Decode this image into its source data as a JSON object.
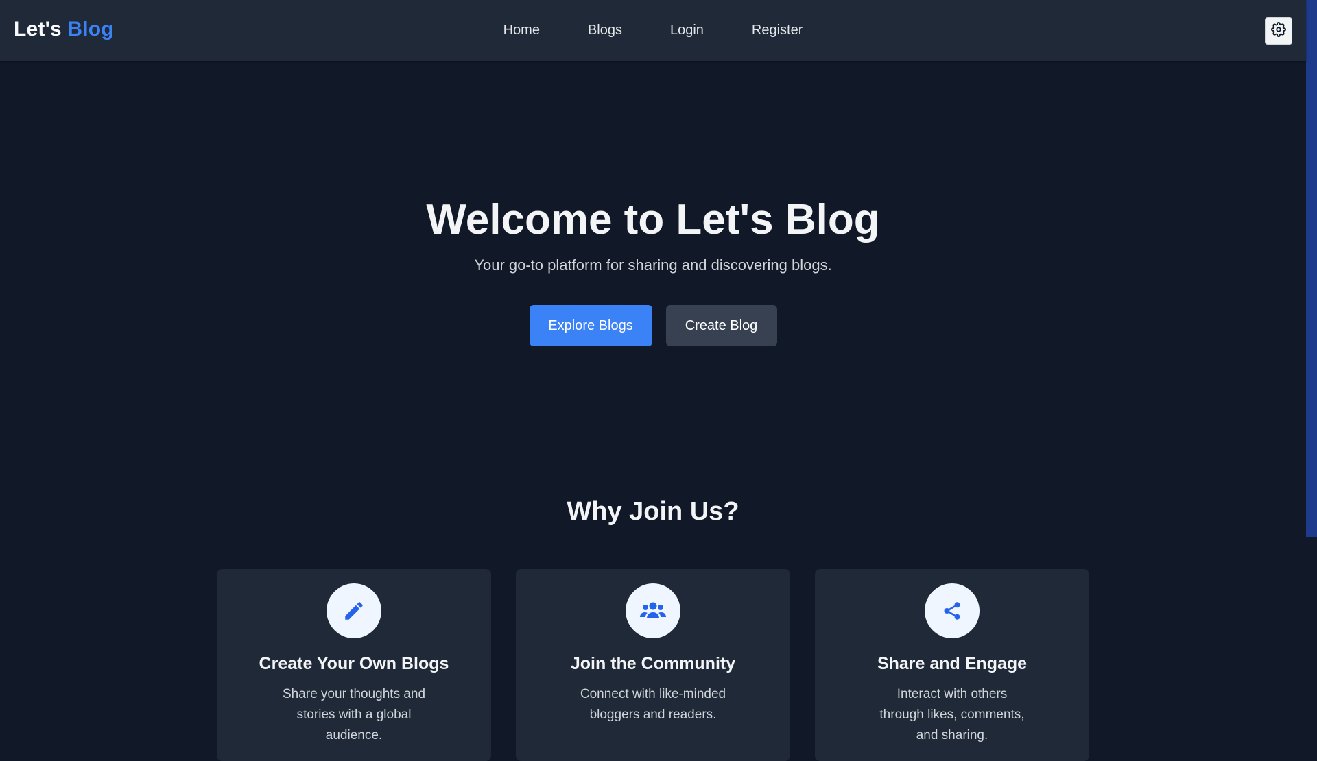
{
  "navbar": {
    "brand_prefix": "Let's",
    "brand_accent": "Blog",
    "links": [
      "Home",
      "Blogs",
      "Login",
      "Register"
    ],
    "theme_toggle_icon": "gear-icon"
  },
  "hero": {
    "title": "Welcome to Let's Blog",
    "subtitle": "Your go-to platform for sharing and discovering blogs.",
    "primary_button": "Explore Blogs",
    "secondary_button": "Create Blog"
  },
  "features": {
    "title": "Why Join Us?",
    "cards": [
      {
        "icon": "pencil-icon",
        "title": "Create Your Own Blogs",
        "description": "Share your thoughts and stories with a global audience."
      },
      {
        "icon": "users-icon",
        "title": "Join the Community",
        "description": "Connect with like-minded bloggers and readers."
      },
      {
        "icon": "share-icon",
        "title": "Share and Engage",
        "description": "Interact with others through likes, comments, and sharing."
      }
    ]
  },
  "colors": {
    "accent": "#3b82f6",
    "background": "#111827",
    "surface": "#1f2937"
  }
}
